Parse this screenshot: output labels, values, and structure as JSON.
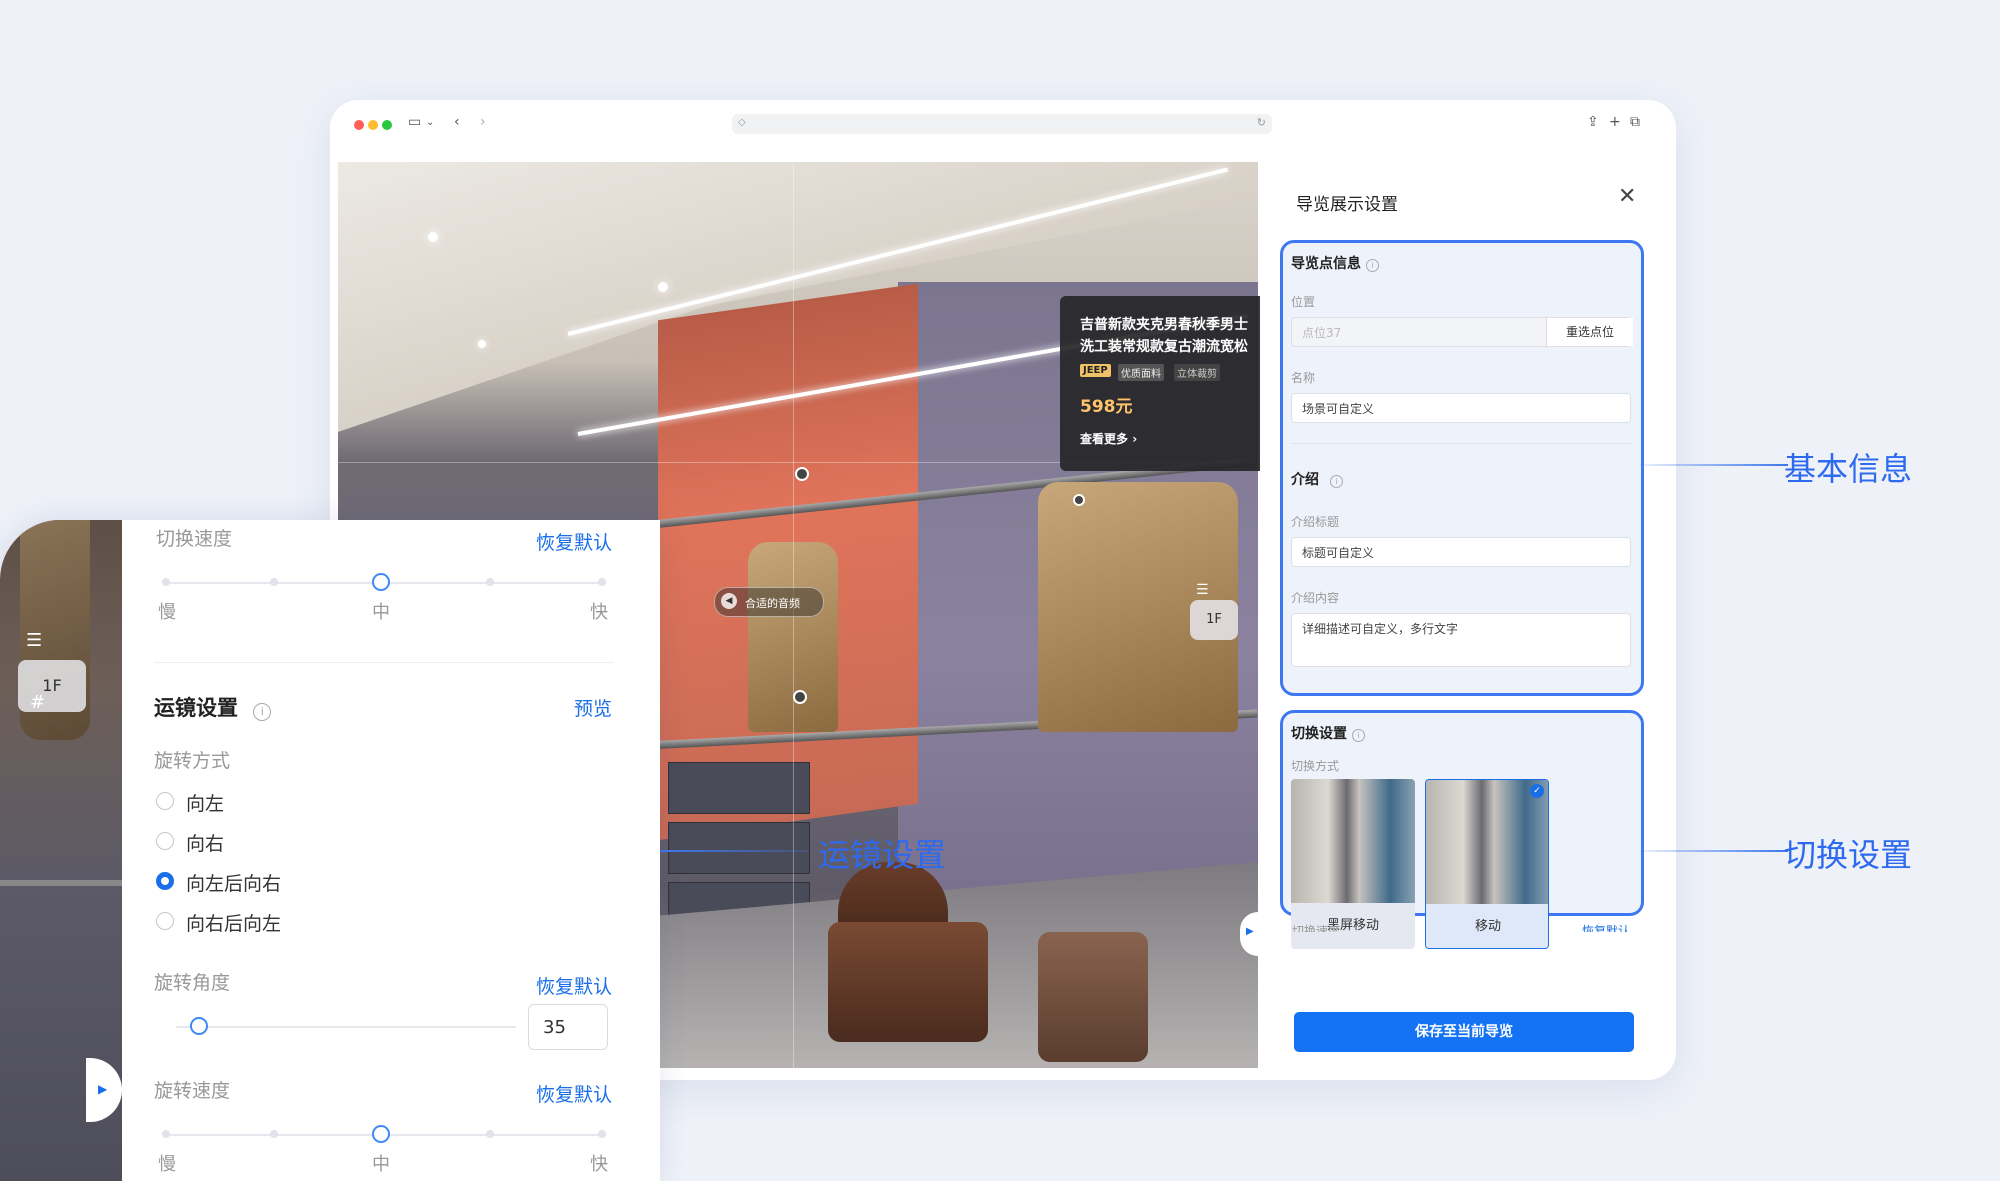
{
  "browser": {
    "controls": {
      "sidebar_icon": "sidebar-icon",
      "back_icon": "back-icon",
      "forward_icon": "forward-icon",
      "share_icon": "share-icon",
      "new_tab_icon": "plus-icon",
      "tabs_icon": "tabs-icon"
    }
  },
  "scene": {
    "product_card": {
      "title_line1": "吉普新款夹克男春秋季男士",
      "title_line2": "洗工装常规款复古潮流宽松",
      "tags": [
        "JEEP",
        "优质面料",
        "立体裁剪"
      ],
      "price": "598元",
      "more_link": "查看更多"
    },
    "audio_label": "合适的音频",
    "floor_badge": "1F"
  },
  "panel": {
    "title": "导览展示设置",
    "basic": {
      "section_title": "导览点信息",
      "position_label": "位置",
      "position_placeholder": "点位37",
      "reselect_button": "重选点位",
      "name_label": "名称",
      "name_value": "场景可自定义",
      "intro_section": "介绍",
      "intro_title_label": "介绍标题",
      "intro_title_value": "标题可自定义",
      "intro_content_label": "介绍内容",
      "intro_content_value": "详细描述可自定义，多行文字"
    },
    "switch": {
      "section_title": "切换设置",
      "mode_label": "切换方式",
      "options": [
        "黑屏移动",
        "移动"
      ],
      "selected": "移动",
      "speed_label_cut": "切换速度",
      "restore_cut": "恢复默认"
    },
    "save_button": "保存至当前导览"
  },
  "callouts": {
    "basic": "基本信息",
    "switch": "切换设置",
    "camera": "运镜设置"
  },
  "zoom_panel": {
    "floor_badge": "1F",
    "switch_speed_label": "切换速度",
    "restore_default": "恢复默认",
    "speed_ticks": [
      "慢",
      "中",
      "快"
    ],
    "speed_level": "中",
    "camera_section": "运镜设置",
    "preview_link": "预览",
    "rotate_mode_label": "旋转方式",
    "rotate_options": [
      "向左",
      "向右",
      "向左后向右",
      "向右后向左"
    ],
    "rotate_selected": "向左后向右",
    "rotate_angle_label": "旋转角度",
    "rotate_angle_value": "35",
    "rotate_speed_label": "旋转速度"
  },
  "colors": {
    "accent": "#1472f5",
    "callout": "#3d78f0",
    "price": "#ffc46b"
  }
}
